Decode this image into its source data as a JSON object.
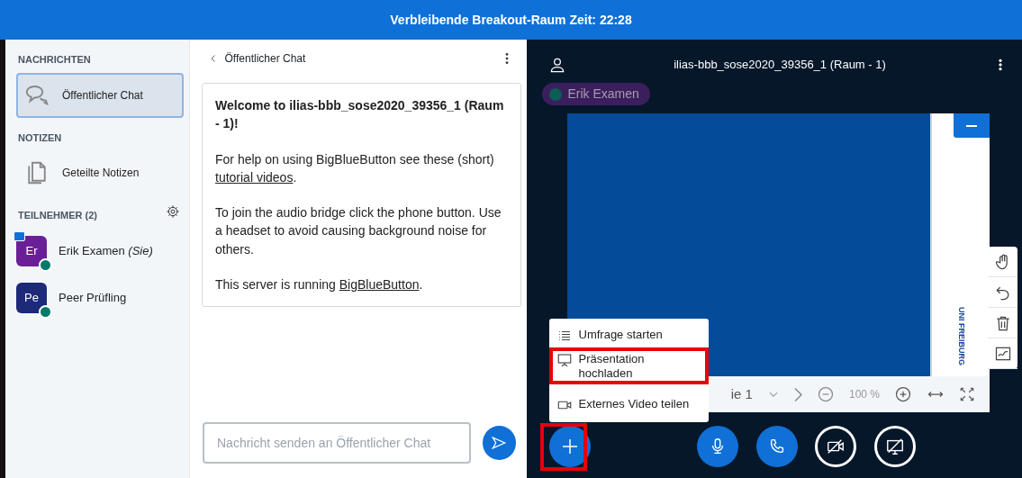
{
  "banner": {
    "text": "Verbleibende Breakout-Raum Zeit: 22:28"
  },
  "sidebar": {
    "sections": [
      {
        "heading": "NACHRICHTEN",
        "items": [
          {
            "label": "Öffentlicher Chat",
            "kind": "chat",
            "selected": true
          }
        ]
      },
      {
        "heading": "NOTIZEN",
        "items": [
          {
            "label": "Geteilte Notizen",
            "kind": "notes",
            "selected": false
          }
        ]
      }
    ],
    "participants": {
      "heading": "TEILNEHMER (2)",
      "users": [
        {
          "initials": "Er",
          "name": "Erik Examen",
          "suffix": "(Sie)",
          "color": "#6b1f96",
          "presenter": true
        },
        {
          "initials": "Pe",
          "name": "Peer Prüfling",
          "color": "#1c2a78",
          "presenter": false
        }
      ]
    }
  },
  "chat": {
    "title": "Öffentlicher Chat",
    "messages": [
      {
        "kind": "welcome",
        "text": "Welcome to ilias-bbb_sose2020_39356_1 (Raum - 1)!"
      },
      {
        "kind": "text",
        "before": "For help on using BigBlueButton see these (short) ",
        "link": "tutorial videos",
        "after": "."
      },
      {
        "kind": "text",
        "before": "To join the audio bridge click the phone button. Use a headset to avoid causing background noise for others."
      },
      {
        "kind": "text",
        "before": "This server is running ",
        "link": "BigBlueButton",
        "after": "."
      }
    ],
    "placeholder": "Nachricht senden an Öffentlicher Chat"
  },
  "presentation": {
    "title": "ilias-bbb_sose2020_39356_1 (Raum - 1)",
    "talker": "Erik Examen",
    "slide_logo": "UNI FREIBURG",
    "pager": {
      "slide": "ie 1",
      "zoom": "100 %"
    }
  },
  "actions_menu": {
    "items": [
      {
        "label": "Umfrage starten",
        "kind": "poll",
        "highlighted": false
      },
      {
        "label": "Präsentation hochladen",
        "kind": "upload",
        "highlighted": true
      },
      {
        "label": "Externes Video teilen",
        "kind": "video",
        "highlighted": false
      }
    ]
  },
  "plus_button": {
    "highlighted": true
  },
  "controls": [
    {
      "kind": "mic",
      "on": true
    },
    {
      "kind": "phone",
      "on": true
    },
    {
      "kind": "camera",
      "on": false
    },
    {
      "kind": "screen",
      "on": false
    }
  ]
}
